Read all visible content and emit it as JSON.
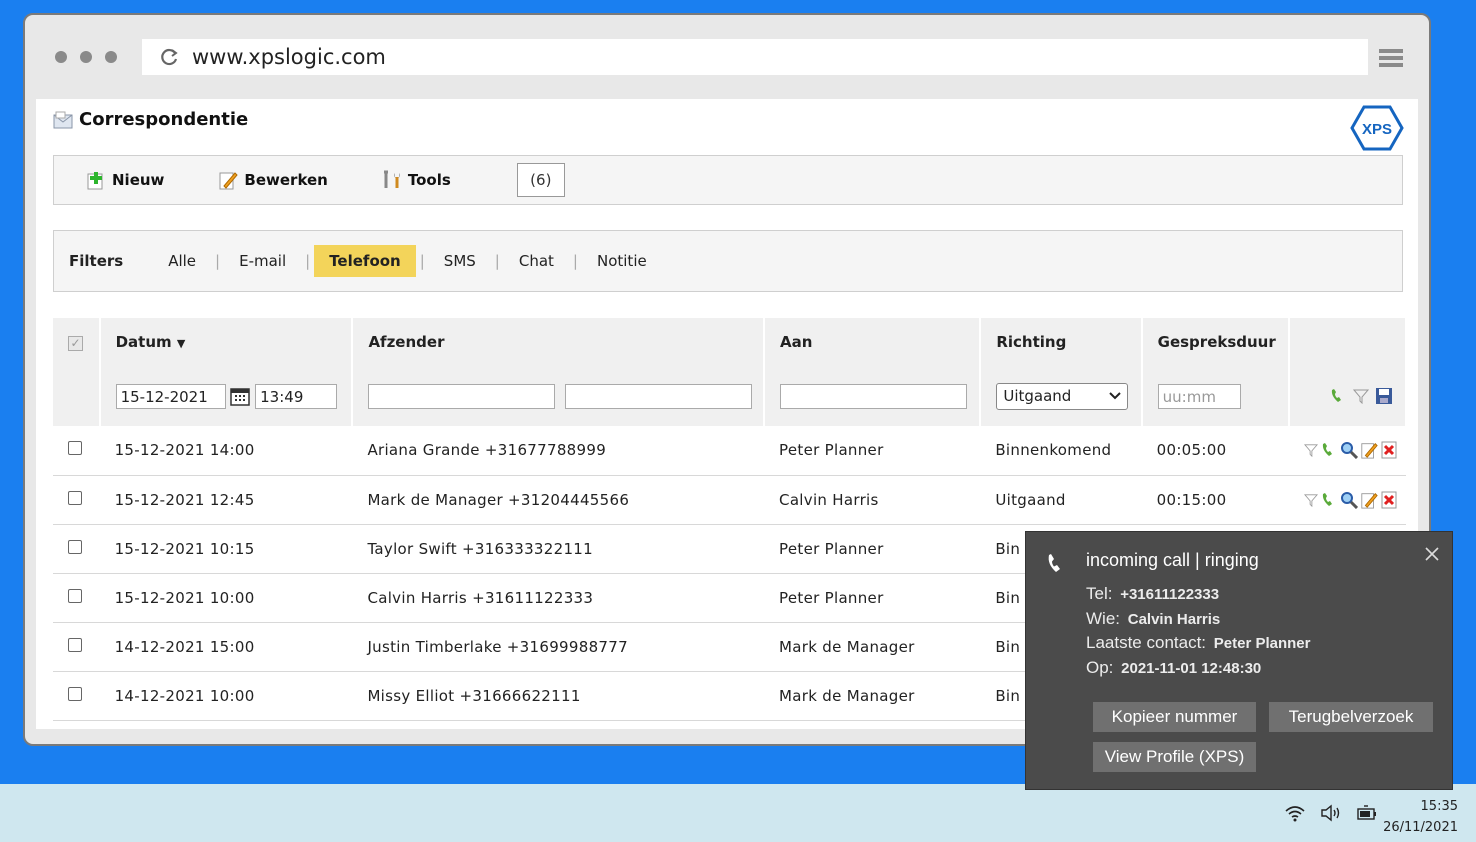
{
  "browser": {
    "url": "www.xpslogic.com"
  },
  "page": {
    "title": "Correspondentie",
    "logo_text": "XPS"
  },
  "toolbar": {
    "new_label": "Nieuw",
    "edit_label": "Bewerken",
    "tools_label": "Tools",
    "count": "(6)"
  },
  "filters": {
    "label": "Filters",
    "items": [
      "Alle",
      "E-mail",
      "Telefoon",
      "SMS",
      "Chat",
      "Notitie"
    ],
    "active": "Telefoon"
  },
  "table": {
    "headers": {
      "datum": "Datum",
      "afzender": "Afzender",
      "aan": "Aan",
      "richting": "Richting",
      "duur": "Gespreksduur"
    },
    "filter_row": {
      "date": "15-12-2021",
      "time": "13:49",
      "richting": "Uitgaand",
      "duur_placeholder": "uu:mm"
    },
    "rows": [
      {
        "datum": "15-12-2021 14:00",
        "afzender": "Ariana Grande +31677788999",
        "aan": "Peter Planner",
        "richting": "Binnenkomend",
        "duur": "00:05:00"
      },
      {
        "datum": "15-12-2021 12:45",
        "afzender": "Mark de Manager +31204445566",
        "aan": "Calvin Harris",
        "richting": "Uitgaand",
        "duur": "00:15:00"
      },
      {
        "datum": "15-12-2021 10:15",
        "afzender": "Taylor Swift +316333322111",
        "aan": "Peter Planner",
        "richting": "Bin",
        "duur": ""
      },
      {
        "datum": "15-12-2021 10:00",
        "afzender": "Calvin Harris +31611122333",
        "aan": "Peter Planner",
        "richting": "Bin",
        "duur": ""
      },
      {
        "datum": "14-12-2021 15:00",
        "afzender": "Justin Timberlake +31699988777",
        "aan": "Mark de Manager",
        "richting": "Bin",
        "duur": ""
      },
      {
        "datum": "14-12-2021 10:00",
        "afzender": "Missy Elliot +31666622111",
        "aan": "Mark de Manager",
        "richting": "Bin",
        "duur": ""
      }
    ]
  },
  "toast": {
    "title": "incoming call | ringing",
    "tel_label": "Tel:",
    "tel": "+31611122333",
    "wie_label": "Wie:",
    "wie": "Calvin Harris",
    "laatste_label": "Laatste contact:",
    "laatste": "Peter Planner",
    "op_label": "Op:",
    "op": "2021-11-01 12:48:30",
    "btn_copy": "Kopieer nummer",
    "btn_callback": "Terugbelverzoek",
    "btn_profile": "View Profile (XPS)"
  },
  "taskbar": {
    "time": "15:35",
    "date": "26/11/2021"
  },
  "colors": {
    "desktop": "#1a7ff0",
    "active_filter": "#f3d45a",
    "toast_bg": "#4b4b4b",
    "logo_blue": "#1565c0"
  }
}
